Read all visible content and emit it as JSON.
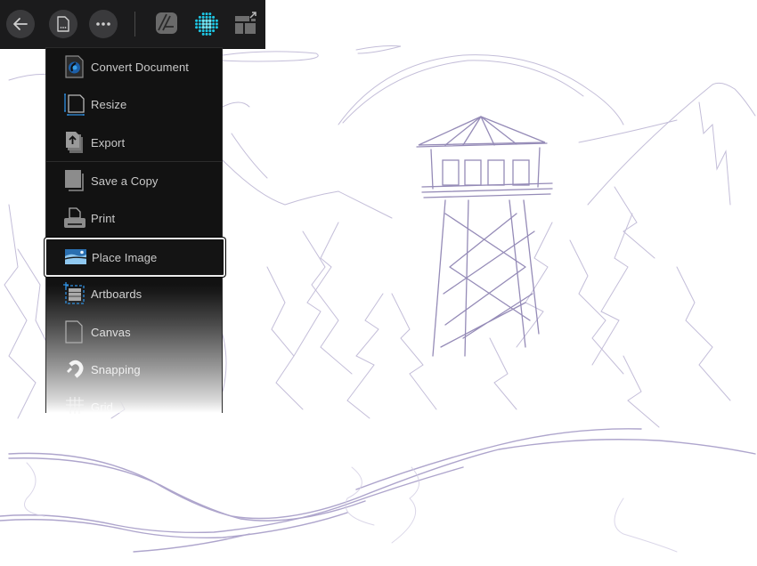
{
  "toolbar": {
    "buttons": [
      {
        "name": "back",
        "icon": "arrow-left-icon"
      },
      {
        "name": "document",
        "icon": "document-icon"
      },
      {
        "name": "more",
        "icon": "ellipsis-icon"
      }
    ],
    "personas": [
      {
        "name": "designer-persona",
        "icon": "affinity-designer-icon",
        "active": false
      },
      {
        "name": "pixel-persona",
        "icon": "pixel-grid-icon",
        "active": true
      },
      {
        "name": "export-persona",
        "icon": "export-persona-icon",
        "active": false
      }
    ],
    "accent_color": "#1ec8e6"
  },
  "document_menu": {
    "items": [
      {
        "label": "Convert Document",
        "icon": "convert-document-icon"
      },
      {
        "label": "Resize",
        "icon": "resize-icon"
      },
      {
        "label": "Export",
        "icon": "export-icon"
      },
      {
        "label": "Save a Copy",
        "icon": "save-copy-icon"
      },
      {
        "label": "Print",
        "icon": "printer-icon"
      },
      {
        "label": "Place Image",
        "icon": "place-image-icon",
        "selected": true
      },
      {
        "label": "Artboards",
        "icon": "artboards-icon"
      },
      {
        "label": "Canvas",
        "icon": "canvas-icon"
      },
      {
        "label": "Snapping",
        "icon": "magnet-icon"
      },
      {
        "label": "Grid",
        "icon": "grid-icon"
      }
    ]
  },
  "canvas": {
    "description": "Pencil sketch of a fire lookout tower among pine trees and mountains",
    "stroke_color": "#8a7fb0"
  }
}
